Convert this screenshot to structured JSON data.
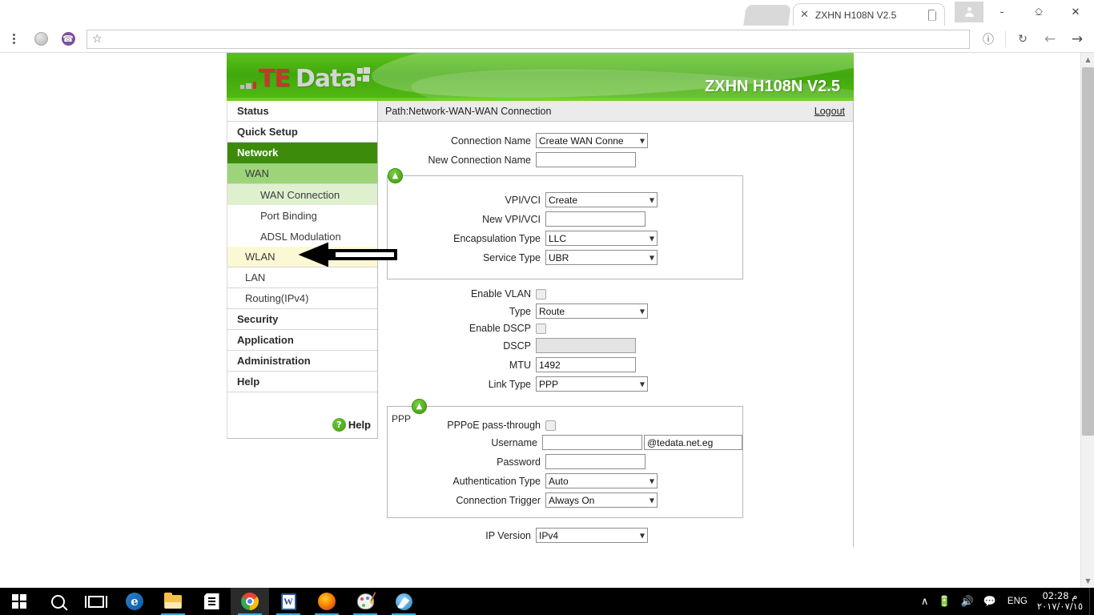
{
  "browser": {
    "tab": {
      "title": "ZXHN H108N V2.5",
      "close_label": "✕",
      "favicon": "page-icon"
    },
    "window_controls": {
      "profile": "profile-icon",
      "minimize": "-",
      "restore": "⎐",
      "close": "✕"
    },
    "toolbar": {
      "menu": "chrome-menu-icon",
      "extension_globe": "globe-extension-icon",
      "extension_viber": "viber-extension-icon",
      "bookmark_star": "☆",
      "url": "",
      "url_placeholder": "",
      "page_info": "ⓘ",
      "reload": "↻",
      "back": "←",
      "forward": "→"
    }
  },
  "router": {
    "logo": {
      "te": "TE",
      "data": "Data"
    },
    "model": "ZXHN H108N V2.5",
    "path": "Path:Network-WAN-WAN Connection",
    "logout": "Logout",
    "sidebar": {
      "items": [
        {
          "label": "Status",
          "level": "top",
          "state": "normal"
        },
        {
          "label": "Quick Setup",
          "level": "top",
          "state": "normal"
        },
        {
          "label": "Network",
          "level": "top",
          "state": "active"
        },
        {
          "label": "WAN",
          "level": "l2",
          "state": "active"
        },
        {
          "label": "WAN Connection",
          "level": "l3",
          "state": "active"
        },
        {
          "label": "Port Binding",
          "level": "l3",
          "state": "normal"
        },
        {
          "label": "ADSL Modulation",
          "level": "l3",
          "state": "normal"
        },
        {
          "label": "WLAN",
          "level": "l2",
          "state": "highlight"
        },
        {
          "label": "LAN",
          "level": "l2",
          "state": "normal"
        },
        {
          "label": "Routing(IPv4)",
          "level": "l2",
          "state": "normal"
        },
        {
          "label": "Security",
          "level": "top",
          "state": "normal"
        },
        {
          "label": "Application",
          "level": "top",
          "state": "normal"
        },
        {
          "label": "Administration",
          "level": "top",
          "state": "normal"
        },
        {
          "label": "Help",
          "level": "top",
          "state": "normal"
        }
      ],
      "help_button": {
        "label": "Help",
        "icon": "question-mark-icon"
      }
    },
    "form": {
      "connection_name": {
        "label": "Connection Name",
        "value": "Create WAN Conne"
      },
      "new_connection_name": {
        "label": "New Connection Name",
        "value": ""
      },
      "vpi_vci": {
        "label": "VPI/VCI",
        "value": "Create"
      },
      "new_vpi_vci": {
        "label": "New VPI/VCI",
        "value": ""
      },
      "encapsulation_type": {
        "label": "Encapsulation Type",
        "value": "LLC"
      },
      "service_type": {
        "label": "Service Type",
        "value": "UBR"
      },
      "enable_vlan": {
        "label": "Enable VLAN",
        "checked": false
      },
      "type": {
        "label": "Type",
        "value": "Route"
      },
      "enable_dscp": {
        "label": "Enable DSCP",
        "checked": false
      },
      "dscp": {
        "label": "DSCP",
        "value": "",
        "disabled": true
      },
      "mtu": {
        "label": "MTU",
        "value": "1492"
      },
      "link_type": {
        "label": "Link Type",
        "value": "PPP"
      },
      "ppp_section": {
        "legend": "PPP",
        "pppoe_passthrough": {
          "label": "PPPoE pass-through",
          "checked": false
        },
        "username": {
          "label": "Username",
          "value": "",
          "suffix": "@tedata.net.eg"
        },
        "password": {
          "label": "Password",
          "value": ""
        },
        "authentication_type": {
          "label": "Authentication Type",
          "value": "Auto"
        },
        "connection_trigger": {
          "label": "Connection Trigger",
          "value": "Always On"
        }
      },
      "ip_version": {
        "label": "IP Version",
        "value": "IPv4"
      },
      "collapse_icon": "chevron-up-icon",
      "dropdown_arrow": "▼"
    },
    "annotation": {
      "type": "left-pointing-arrow",
      "points_to": "WLAN"
    }
  },
  "taskbar": {
    "items": [
      {
        "name": "start-button",
        "icon": "windows-logo-icon"
      },
      {
        "name": "search-button",
        "icon": "search-icon"
      },
      {
        "name": "task-view-button",
        "icon": "task-view-icon"
      },
      {
        "name": "edge-button",
        "icon": "edge-icon"
      },
      {
        "name": "file-explorer-button",
        "icon": "folder-icon"
      },
      {
        "name": "microsoft-store-button",
        "icon": "store-icon"
      },
      {
        "name": "chrome-button",
        "icon": "chrome-icon"
      },
      {
        "name": "word-button",
        "icon": "word-icon"
      },
      {
        "name": "firefox-button",
        "icon": "firefox-icon"
      },
      {
        "name": "paint-button",
        "icon": "paint-icon"
      },
      {
        "name": "swift-button",
        "icon": "swift-icon"
      }
    ],
    "tray": {
      "show_hidden": "∧",
      "battery": "battery-icon",
      "volume": "volume-icon",
      "action_center": "notifications-icon",
      "language": "ENG",
      "time": "02:28 م",
      "date": "٢٠١٧/٠٧/١٥"
    }
  }
}
